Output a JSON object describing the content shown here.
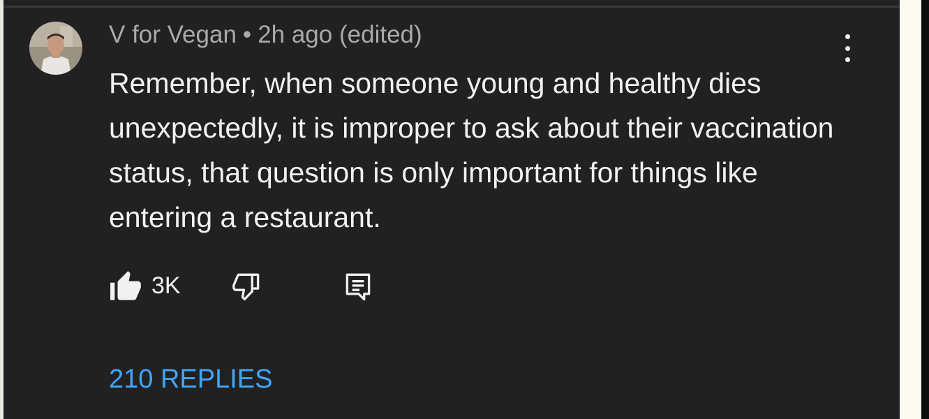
{
  "comment": {
    "author": "V for Vegan",
    "separator": "•",
    "time": "2h ago",
    "edited": "(edited)",
    "text": "Remember, when someone young and healthy dies unexpectedly, it is improper to ask about their vaccination status, that question is only important for things like entering a restaurant.",
    "avatar_icon": "profile-photo",
    "menu_icon": "more-vertical-icon"
  },
  "actions": {
    "like_icon": "thumbs-up-filled-icon",
    "like_count": "3K",
    "dislike_icon": "thumbs-down-outline-icon",
    "reply_icon": "comment-reply-icon"
  },
  "replies": {
    "label": "210 REPLIES"
  },
  "colors": {
    "panel_bg": "#212121",
    "text_primary": "#f1f1f1",
    "text_secondary": "#aaaaaa",
    "link_blue": "#3ea6ff"
  }
}
